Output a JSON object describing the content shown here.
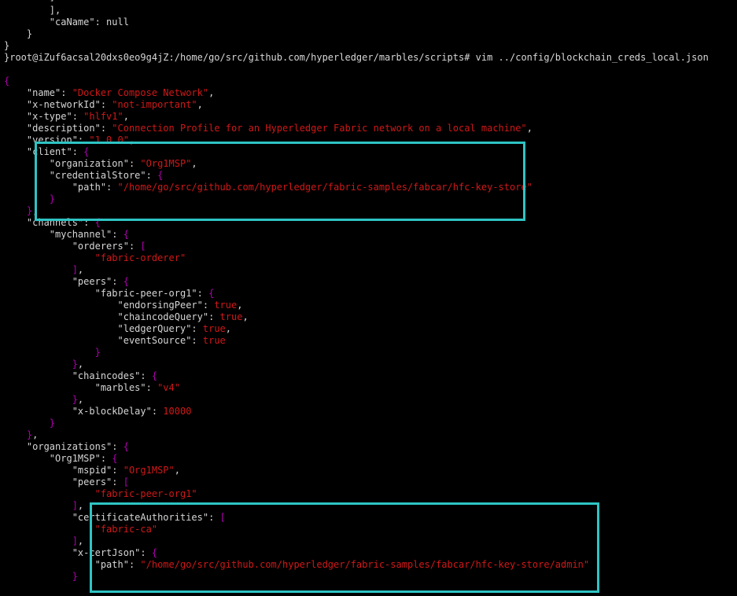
{
  "terminal": {
    "top_lines": [
      "        ]",
      "        ],",
      "        \"caName\": null",
      "    }",
      "}"
    ],
    "command_line": "}root@iZuf6acsal20dxs0eo9g4jZ:/home/go/src/github.com/hyperledger/marbles/scripts# vim ../config/blockchain_creds_local.json",
    "editor_lines": [
      [
        {
          "t": "{",
          "c": "p"
        }
      ],
      [
        {
          "t": "    \"name\": ",
          "c": "w"
        },
        {
          "t": "\"Docker Compose Network\"",
          "c": "r"
        },
        {
          "t": ",",
          "c": "w"
        }
      ],
      [
        {
          "t": "    \"x-networkId\": ",
          "c": "w"
        },
        {
          "t": "\"not-important\"",
          "c": "r"
        },
        {
          "t": ",",
          "c": "w"
        }
      ],
      [
        {
          "t": "    \"x-type\": ",
          "c": "w"
        },
        {
          "t": "\"hlfv1\"",
          "c": "r"
        },
        {
          "t": ",",
          "c": "w"
        }
      ],
      [
        {
          "t": "    \"description\": ",
          "c": "w"
        },
        {
          "t": "\"Connection Profile for an Hyperledger Fabric network on a local machine\"",
          "c": "r"
        },
        {
          "t": ",",
          "c": "w"
        }
      ],
      [
        {
          "t": "    \"version\": ",
          "c": "w"
        },
        {
          "t": "\"1.0.0\"",
          "c": "r"
        },
        {
          "t": ",",
          "c": "w"
        }
      ],
      [
        {
          "t": "    \"client\": ",
          "c": "w"
        },
        {
          "t": "{",
          "c": "p"
        }
      ],
      [
        {
          "t": "        \"organization\": ",
          "c": "w"
        },
        {
          "t": "\"Org1MSP\"",
          "c": "r"
        },
        {
          "t": ",",
          "c": "w"
        }
      ],
      [
        {
          "t": "        \"credentialStore\": ",
          "c": "w"
        },
        {
          "t": "{",
          "c": "p"
        }
      ],
      [
        {
          "t": "            \"path\": ",
          "c": "w"
        },
        {
          "t": "\"/home/go/src/github.com/hyperledger/fabric-samples/fabcar/hfc-key-store\"",
          "c": "r"
        }
      ],
      [
        {
          "t": "        }",
          "c": "p"
        }
      ],
      [
        {
          "t": "    }",
          "c": "p"
        },
        {
          "t": ",",
          "c": "w"
        }
      ],
      [
        {
          "t": "    \"channels\": ",
          "c": "w"
        },
        {
          "t": "{",
          "c": "p"
        }
      ],
      [
        {
          "t": "        \"mychannel\": ",
          "c": "w"
        },
        {
          "t": "{",
          "c": "p"
        }
      ],
      [
        {
          "t": "            \"orderers\": ",
          "c": "w"
        },
        {
          "t": "[",
          "c": "p"
        }
      ],
      [
        {
          "t": "                ",
          "c": "w"
        },
        {
          "t": "\"fabric-orderer\"",
          "c": "r"
        }
      ],
      [
        {
          "t": "            ]",
          "c": "p"
        },
        {
          "t": ",",
          "c": "w"
        }
      ],
      [
        {
          "t": "            \"peers\": ",
          "c": "w"
        },
        {
          "t": "{",
          "c": "p"
        }
      ],
      [
        {
          "t": "                \"fabric-peer-org1\": ",
          "c": "w"
        },
        {
          "t": "{",
          "c": "p"
        }
      ],
      [
        {
          "t": "                    \"endorsingPeer\": ",
          "c": "w"
        },
        {
          "t": "true",
          "c": "r"
        },
        {
          "t": ",",
          "c": "w"
        }
      ],
      [
        {
          "t": "                    \"chaincodeQuery\": ",
          "c": "w"
        },
        {
          "t": "true",
          "c": "r"
        },
        {
          "t": ",",
          "c": "w"
        }
      ],
      [
        {
          "t": "                    \"ledgerQuery\": ",
          "c": "w"
        },
        {
          "t": "true",
          "c": "r"
        },
        {
          "t": ",",
          "c": "w"
        }
      ],
      [
        {
          "t": "                    \"eventSource\": ",
          "c": "w"
        },
        {
          "t": "true",
          "c": "r"
        }
      ],
      [
        {
          "t": "                }",
          "c": "p"
        }
      ],
      [
        {
          "t": "            }",
          "c": "p"
        },
        {
          "t": ",",
          "c": "w"
        }
      ],
      [
        {
          "t": "            \"chaincodes\": ",
          "c": "w"
        },
        {
          "t": "{",
          "c": "p"
        }
      ],
      [
        {
          "t": "                \"marbles\": ",
          "c": "w"
        },
        {
          "t": "\"v4\"",
          "c": "r"
        }
      ],
      [
        {
          "t": "            }",
          "c": "p"
        },
        {
          "t": ",",
          "c": "w"
        }
      ],
      [
        {
          "t": "            \"x-blockDelay\": ",
          "c": "w"
        },
        {
          "t": "10000",
          "c": "r"
        }
      ],
      [
        {
          "t": "        }",
          "c": "p"
        }
      ],
      [
        {
          "t": "    }",
          "c": "p"
        },
        {
          "t": ",",
          "c": "w"
        }
      ],
      [
        {
          "t": "    \"organizations\": ",
          "c": "w"
        },
        {
          "t": "{",
          "c": "p"
        }
      ],
      [
        {
          "t": "        \"Org1MSP\": ",
          "c": "w"
        },
        {
          "t": "{",
          "c": "p"
        }
      ],
      [
        {
          "t": "            \"mspid\": ",
          "c": "w"
        },
        {
          "t": "\"Org1MSP\"",
          "c": "r"
        },
        {
          "t": ",",
          "c": "w"
        }
      ],
      [
        {
          "t": "            \"peers\": ",
          "c": "w"
        },
        {
          "t": "[",
          "c": "p"
        }
      ],
      [
        {
          "t": "                ",
          "c": "w"
        },
        {
          "t": "\"fabric-peer-org1\"",
          "c": "r"
        }
      ],
      [
        {
          "t": "            ]",
          "c": "p"
        },
        {
          "t": ",",
          "c": "w"
        }
      ],
      [
        {
          "t": "            \"certificateAuthorities\": ",
          "c": "w"
        },
        {
          "t": "[",
          "c": "p"
        }
      ],
      [
        {
          "t": "                ",
          "c": "w"
        },
        {
          "t": "\"fabric-ca\"",
          "c": "r"
        }
      ],
      [
        {
          "t": "            ]",
          "c": "p"
        },
        {
          "t": ",",
          "c": "w"
        }
      ],
      [
        {
          "t": "            \"x-certJson\": ",
          "c": "w"
        },
        {
          "t": "{",
          "c": "p"
        }
      ],
      [
        {
          "t": "                \"path\": ",
          "c": "w"
        },
        {
          "t": "\"/home/go/src/github.com/hyperledger/fabric-samples/fabcar/hfc-key-store/admin\"",
          "c": "r"
        }
      ],
      [
        {
          "t": "            }",
          "c": "p"
        }
      ]
    ]
  },
  "colors": {
    "background": "#000000",
    "text": "#d6d6d6",
    "brace": "#b000b0",
    "string": "#d01818",
    "highlight_box": "#2ec4c4"
  }
}
